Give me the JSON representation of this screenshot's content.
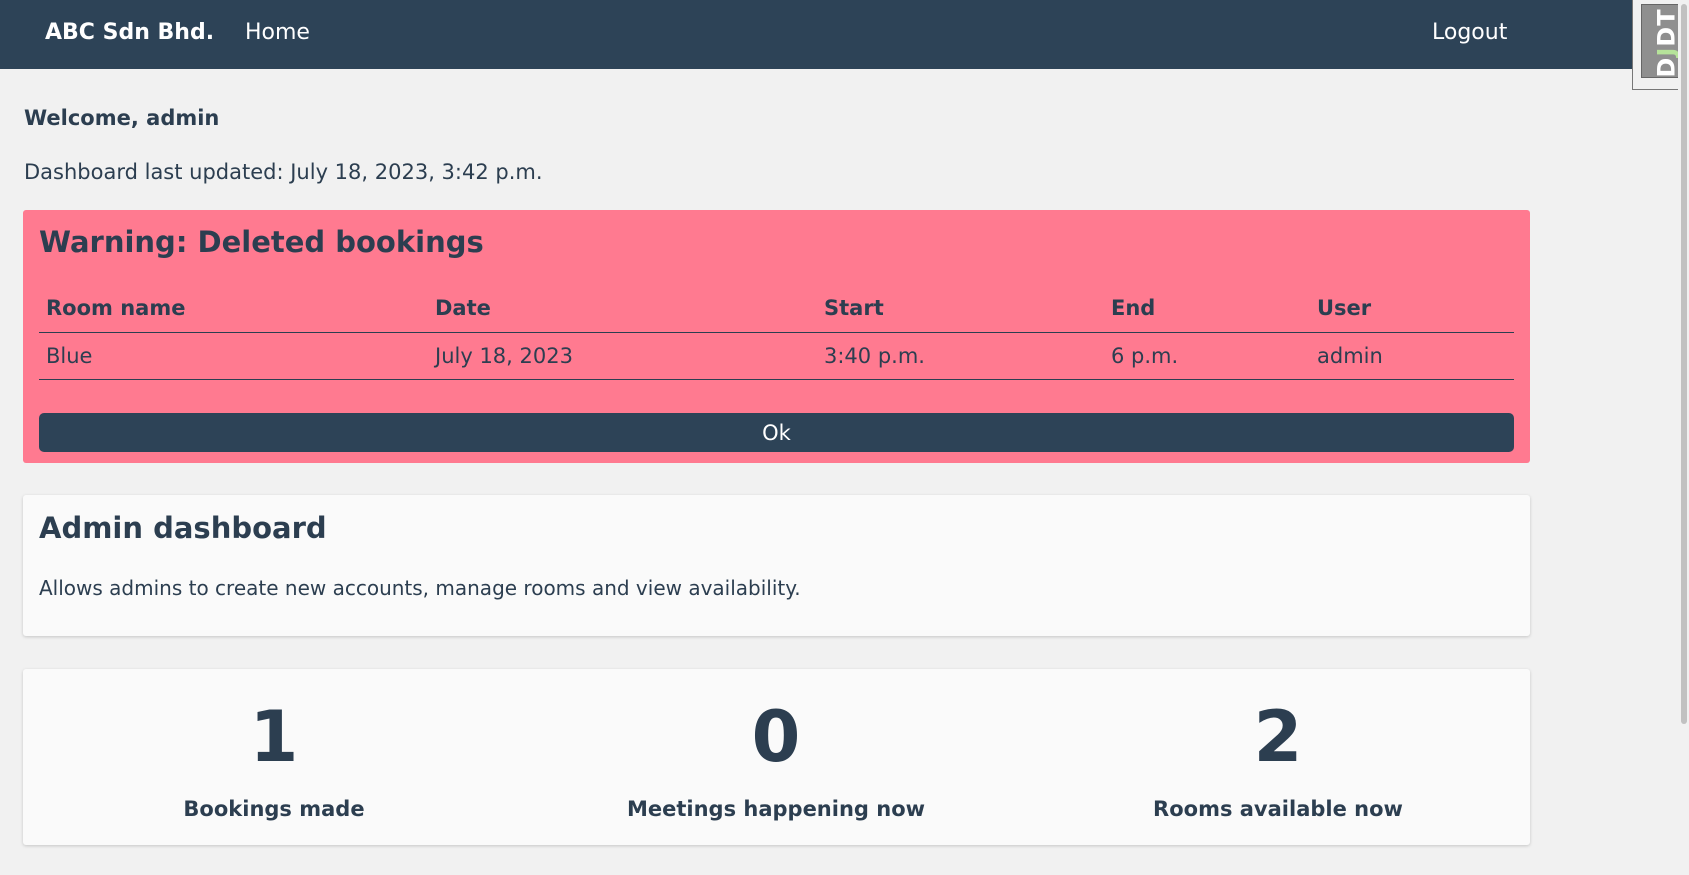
{
  "navbar": {
    "brand": "ABC Sdn Bhd.",
    "home_label": "Home",
    "logout_label": "Logout"
  },
  "debug_toolbar": {
    "handle_label_d": "D",
    "handle_label_j": "J",
    "handle_label_dt": "DT"
  },
  "welcome_text": "Welcome, admin",
  "last_updated_text": "Dashboard last updated: July 18, 2023, 3:42 p.m.",
  "warning": {
    "title": "Warning: Deleted bookings",
    "columns": [
      "Room name",
      "Date",
      "Start",
      "End",
      "User"
    ],
    "rows": [
      [
        "Blue",
        "July 18, 2023",
        "3:40 p.m.",
        "6 p.m.",
        "admin"
      ]
    ],
    "ok_label": "Ok",
    "background_color": "#ff7a90"
  },
  "admin_card": {
    "title": "Admin dashboard",
    "description": "Allows admins to create new accounts, manage rooms and view availability."
  },
  "stats": [
    {
      "value": "1",
      "label": "Bookings made"
    },
    {
      "value": "0",
      "label": "Meetings happening now"
    },
    {
      "value": "2",
      "label": "Rooms available now"
    }
  ],
  "colors": {
    "navbar": "#2d4357",
    "text": "#2c3e50",
    "page_background": "#f1f1f1"
  }
}
